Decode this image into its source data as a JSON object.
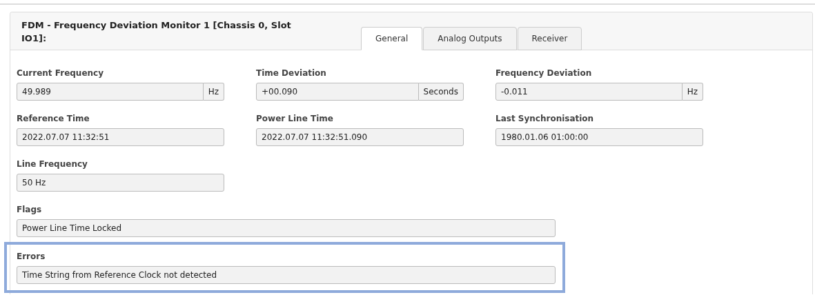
{
  "panel": {
    "title": "FDM - Frequency Deviation Monitor 1 [Chassis 0, Slot IO1]:",
    "tabs": [
      {
        "label": "General",
        "selected": true
      },
      {
        "label": "Analog Outputs",
        "selected": false
      },
      {
        "label": "Receiver",
        "selected": false
      }
    ],
    "rows": [
      {
        "fields": [
          {
            "kind": "short",
            "label": "Current Frequency",
            "value": "49.989",
            "unit": "Hz",
            "highlighted": false
          },
          {
            "kind": "short",
            "label": "Time Deviation",
            "value": "+00.090",
            "unit": "Seconds",
            "highlighted": false
          },
          {
            "kind": "short",
            "label": "Frequency Deviation",
            "value": "-0.011",
            "unit": "Hz",
            "highlighted": false
          }
        ]
      },
      {
        "fields": [
          {
            "kind": "short",
            "label": "Reference Time",
            "value": "2022.07.07 11:32:51",
            "highlighted": false
          },
          {
            "kind": "short",
            "label": "Power Line Time",
            "value": "2022.07.07 11:32:51.090",
            "highlighted": false
          },
          {
            "kind": "short",
            "label": "Last Synchronisation",
            "value": "1980.01.06 01:00:00",
            "highlighted": false
          }
        ]
      },
      {
        "fields": [
          {
            "kind": "short",
            "label": "Line Frequency",
            "value": "50 Hz",
            "highlighted": false
          }
        ]
      },
      {
        "fields": [
          {
            "kind": "wide",
            "label": "Flags",
            "value": "Power Line Time Locked",
            "highlighted": false
          }
        ]
      },
      {
        "fields": [
          {
            "kind": "wide",
            "label": "Errors",
            "value": "Time String from Reference Clock not detected",
            "highlighted": true
          }
        ]
      }
    ]
  }
}
